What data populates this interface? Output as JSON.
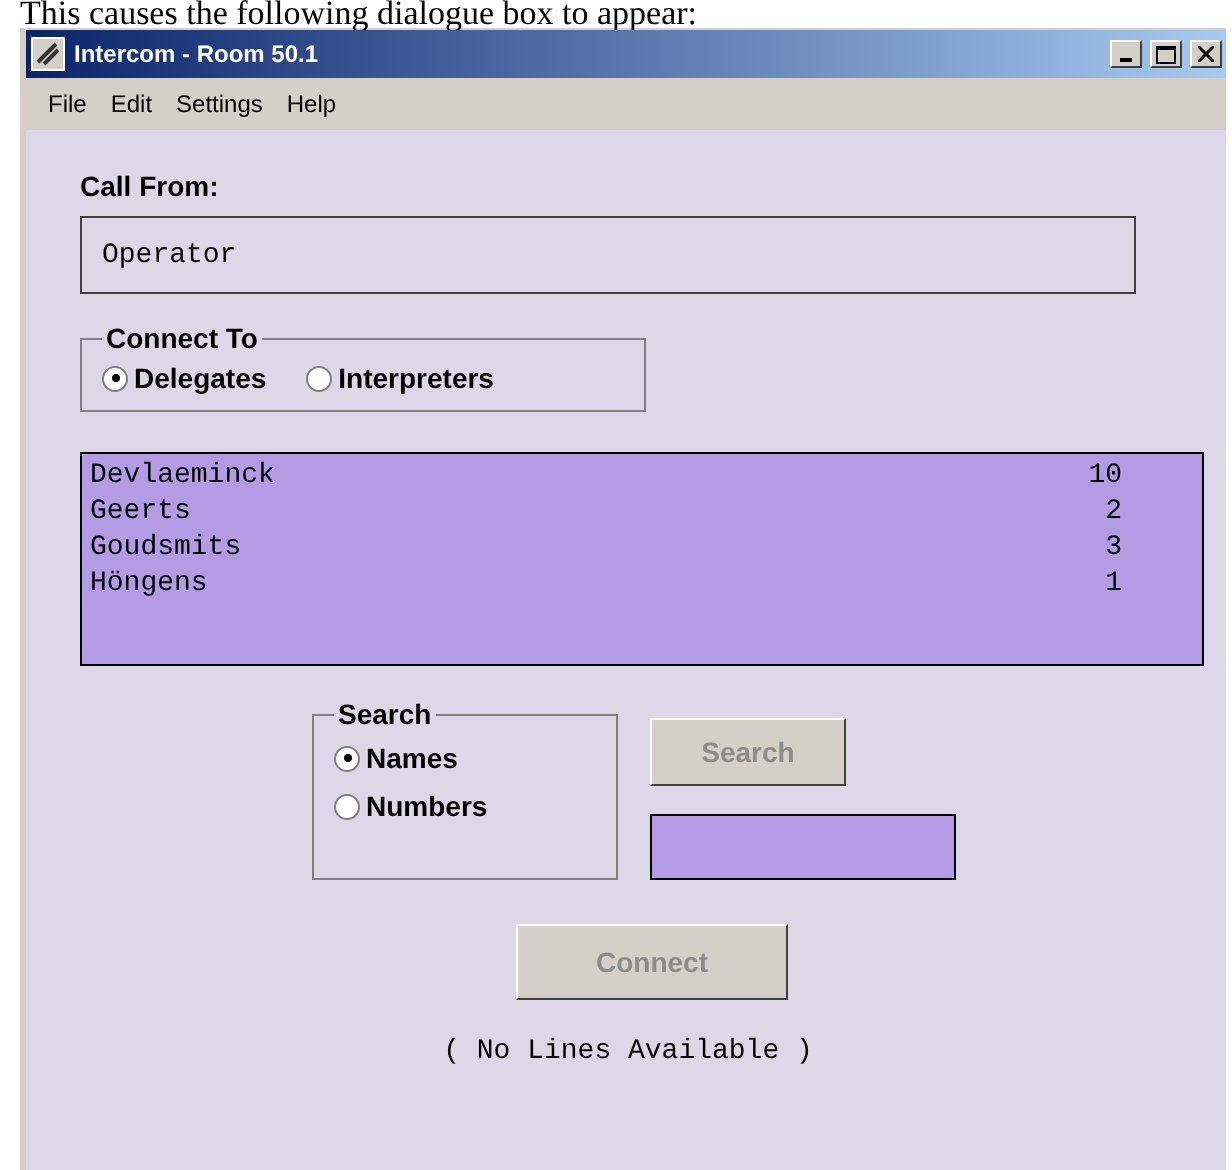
{
  "caption": "This causes the following dialogue box to appear:",
  "window": {
    "title": "Intercom - Room 50.1"
  },
  "menu": [
    "File",
    "Edit",
    "Settings",
    "Help"
  ],
  "call_from": {
    "label": "Call From:",
    "value": "Operator"
  },
  "connect_to": {
    "legend": "Connect To",
    "options": [
      {
        "label": "Delegates",
        "selected": true
      },
      {
        "label": "Interpreters",
        "selected": false
      }
    ]
  },
  "list": [
    {
      "name": "Devlaeminck",
      "number": "10"
    },
    {
      "name": "Geerts",
      "number": "2"
    },
    {
      "name": "Goudsmits",
      "number": "3"
    },
    {
      "name": "Höngens",
      "number": "1"
    }
  ],
  "search": {
    "legend": "Search",
    "options": [
      {
        "label": "Names",
        "selected": true
      },
      {
        "label": "Numbers",
        "selected": false
      }
    ],
    "button": {
      "label": "Search",
      "disabled": true
    }
  },
  "connect_button": {
    "label": "Connect",
    "disabled": true
  },
  "status": "( No Lines Available )"
}
